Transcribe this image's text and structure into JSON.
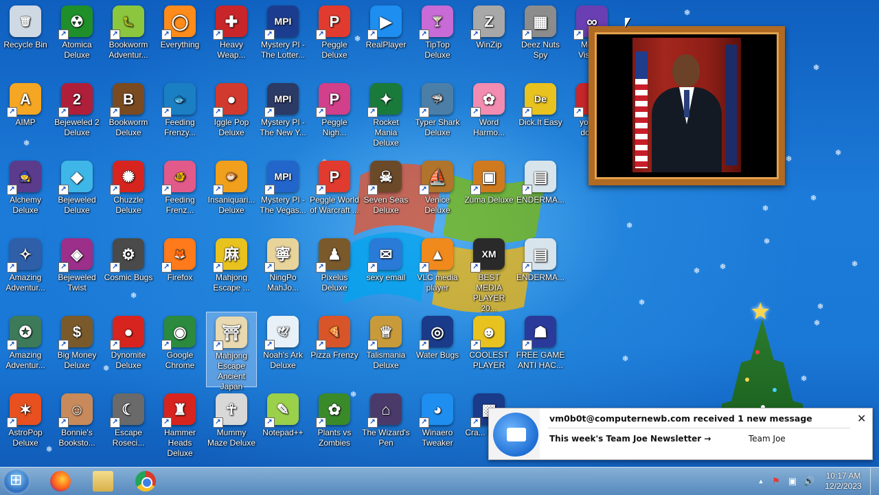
{
  "desktop": {
    "icons": [
      {
        "label": "Recycle Bin",
        "color": "#cfd9e4",
        "glyph": "🗑",
        "shortcut": false
      },
      {
        "label": "Atomica Deluxe",
        "color": "#1f8f2a",
        "glyph": "☢",
        "shortcut": true
      },
      {
        "label": "Bookworm Adventur...",
        "color": "#8cc63f",
        "glyph": "🐛",
        "shortcut": true
      },
      {
        "label": "Everything",
        "color": "#ff8c1a",
        "glyph": "◯",
        "shortcut": true
      },
      {
        "label": "Heavy Weap...",
        "color": "#c8262a",
        "glyph": "✚",
        "shortcut": true
      },
      {
        "label": "Mystery PI - The Lotter...",
        "color": "#1c3d8f",
        "glyph": "MPI",
        "shortcut": true
      },
      {
        "label": "Peggle Deluxe",
        "color": "#e03b2e",
        "glyph": "P",
        "shortcut": true
      },
      {
        "label": "RealPlayer",
        "color": "#1e8ef0",
        "glyph": "▶",
        "shortcut": true
      },
      {
        "label": "TipTop Deluxe",
        "color": "#c86bd6",
        "glyph": "🍸",
        "shortcut": true
      },
      {
        "label": "WinZip",
        "color": "#a8a8a8",
        "glyph": "Z",
        "shortcut": true
      },
      {
        "label": "Deez Nuts Spy",
        "color": "#8c8c8c",
        "glyph": "▦",
        "shortcut": true
      },
      {
        "label": "Micr... Visua...",
        "color": "#6a3fb4",
        "glyph": "∞",
        "shortcut": true
      },
      {
        "label": "AIMP",
        "color": "#f5a623",
        "glyph": "A",
        "shortcut": true
      },
      {
        "label": "Bejeweled 2 Deluxe",
        "color": "#b01f3a",
        "glyph": "2",
        "shortcut": true
      },
      {
        "label": "Bookworm Deluxe",
        "color": "#7a4a20",
        "glyph": "B",
        "shortcut": true
      },
      {
        "label": "Feeding Frenzy...",
        "color": "#1b7fc4",
        "glyph": "🐟",
        "shortcut": true
      },
      {
        "label": "Iggle Pop Deluxe",
        "color": "#d13a2f",
        "glyph": "●",
        "shortcut": true
      },
      {
        "label": "Mystery PI - The New Y...",
        "color": "#2c3a66",
        "glyph": "MPI",
        "shortcut": true
      },
      {
        "label": "Peggle Nigh...",
        "color": "#d23f8a",
        "glyph": "P",
        "shortcut": true
      },
      {
        "label": "Rocket Mania Deluxe",
        "color": "#1a7a3a",
        "glyph": "✦",
        "shortcut": true
      },
      {
        "label": "Typer Shark Deluxe",
        "color": "#4c7fa8",
        "glyph": "🦈",
        "shortcut": true
      },
      {
        "label": "Word Harmo...",
        "color": "#f28cb0",
        "glyph": "✿",
        "shortcut": true
      },
      {
        "label": "Dick.It Easy",
        "color": "#e8c21e",
        "glyph": "De",
        "shortcut": true
      },
      {
        "label": "you r... dont...",
        "color": "#c8262a",
        "glyph": "!",
        "shortcut": true
      },
      {
        "label": "Alchemy Deluxe",
        "color": "#5a3b8c",
        "glyph": "🧙",
        "shortcut": true
      },
      {
        "label": "Bejeweled Deluxe",
        "color": "#3fb6e8",
        "glyph": "◆",
        "shortcut": true
      },
      {
        "label": "Chuzzle Deluxe",
        "color": "#d8241f",
        "glyph": "✺",
        "shortcut": true
      },
      {
        "label": "Feeding Frenz...",
        "color": "#e25a8a",
        "glyph": "🐠",
        "shortcut": true
      },
      {
        "label": "Insaniquari... Deluxe",
        "color": "#f0a01c",
        "glyph": "🐡",
        "shortcut": true
      },
      {
        "label": "Mystery PI - The Vegas...",
        "color": "#2266cc",
        "glyph": "MPI",
        "shortcut": true
      },
      {
        "label": "Peggle World of Warcraft ...",
        "color": "#e03b2e",
        "glyph": "P",
        "shortcut": true
      },
      {
        "label": "Seven Seas Deluxe",
        "color": "#6b4a2a",
        "glyph": "☠",
        "shortcut": true
      },
      {
        "label": "Venice Deluxe",
        "color": "#b0742c",
        "glyph": "⛵",
        "shortcut": true
      },
      {
        "label": "Zuma Deluxe",
        "color": "#d07a1f",
        "glyph": "▣",
        "shortcut": true
      },
      {
        "label": "ENDERMA...",
        "color": "#d8e4ec",
        "glyph": "▤",
        "shortcut": true
      },
      {
        "label": "Amazing Adventur...",
        "color": "#2f5fa8",
        "glyph": "✧",
        "shortcut": true
      },
      {
        "label": "Bejeweled Twist",
        "color": "#9b2f8a",
        "glyph": "◈",
        "shortcut": true
      },
      {
        "label": "Cosmic Bugs",
        "color": "#4a4a4a",
        "glyph": "⚙",
        "shortcut": true
      },
      {
        "label": "Firefox",
        "color": "#ff7a1a",
        "glyph": "🦊",
        "shortcut": true
      },
      {
        "label": "Mahjong Escape ...",
        "color": "#e8c21e",
        "glyph": "麻",
        "shortcut": true
      },
      {
        "label": "NingPo MahJo...",
        "color": "#e8d49a",
        "glyph": "寧",
        "shortcut": true
      },
      {
        "label": "Pixelus Deluxe",
        "color": "#7a5a2a",
        "glyph": "♟",
        "shortcut": true
      },
      {
        "label": "sexy email",
        "color": "#2a7ad8",
        "glyph": "✉",
        "shortcut": true
      },
      {
        "label": "VLC media player",
        "color": "#f08a1c",
        "glyph": "▲",
        "shortcut": true
      },
      {
        "label": "BEST MEDIA PLAYER 20...",
        "color": "#2a2a2a",
        "glyph": "XM",
        "shortcut": true
      },
      {
        "label": "ENDERMA...",
        "color": "#d8e4ec",
        "glyph": "▤",
        "shortcut": true
      },
      {
        "label": "Amazing Adventur...",
        "color": "#3c7a5a",
        "glyph": "✪",
        "shortcut": true
      },
      {
        "label": "Big Money Deluxe",
        "color": "#7a5a2a",
        "glyph": "$",
        "shortcut": true
      },
      {
        "label": "Dynomite Deluxe",
        "color": "#d8241f",
        "glyph": "●",
        "shortcut": true
      },
      {
        "label": "Google Chrome",
        "color": "#2b8a3e",
        "glyph": "◉",
        "shortcut": true
      },
      {
        "label": "Mahjong Escape Ancient Japan",
        "color": "#e8d9b0",
        "glyph": "⛩",
        "shortcut": true
      },
      {
        "label": "Noah's Ark Deluxe",
        "color": "#e8f0f8",
        "glyph": "🕊",
        "shortcut": true
      },
      {
        "label": "Pizza Frenzy",
        "color": "#d8552a",
        "glyph": "🍕",
        "shortcut": true
      },
      {
        "label": "Talismania Deluxe",
        "color": "#c89a3a",
        "glyph": "♕",
        "shortcut": true
      },
      {
        "label": "Water Bugs",
        "color": "#1a3a8a",
        "glyph": "◎",
        "shortcut": true
      },
      {
        "label": "COOLEST PLAYER",
        "color": "#e8c21e",
        "glyph": "☻",
        "shortcut": true
      },
      {
        "label": "FREE GAME ANTI HAC...",
        "color": "#2a3a9a",
        "glyph": "☗",
        "shortcut": true
      },
      {
        "label": "AstroPop Deluxe",
        "color": "#e8501f",
        "glyph": "✶",
        "shortcut": true
      },
      {
        "label": "Bonnie's Booksto...",
        "color": "#c88a5a",
        "glyph": "☺",
        "shortcut": true
      },
      {
        "label": "Escape Roseci...",
        "color": "#6a6a6a",
        "glyph": "☾",
        "shortcut": true
      },
      {
        "label": "Hammer Heads Deluxe",
        "color": "#d8241f",
        "glyph": "♜",
        "shortcut": true
      },
      {
        "label": "Mummy Maze Deluxe",
        "color": "#d8d8d8",
        "glyph": "☥",
        "shortcut": true
      },
      {
        "label": "Notepad++",
        "color": "#9ad04a",
        "glyph": "✎",
        "shortcut": true
      },
      {
        "label": "Plants vs Zombies",
        "color": "#3a8a2a",
        "glyph": "✿",
        "shortcut": true
      },
      {
        "label": "The Wizard's Pen",
        "color": "#4a3a6a",
        "glyph": "⌂",
        "shortcut": true
      },
      {
        "label": "Winaero Tweaker",
        "color": "#1e8ef0",
        "glyph": "◕",
        "shortcut": true
      },
      {
        "label": "Cra... Brow...",
        "color": "#1a3a8a",
        "glyph": "▩",
        "shortcut": true
      }
    ]
  },
  "notification": {
    "title": "vm0b0t@computernewb.com received 1 new message",
    "subject": "This week's Team Joe Newsletter →",
    "sender": "Team Joe",
    "close_glyph": "✕"
  },
  "taskbar": {
    "clock_time": "10:17 AM",
    "clock_date": "12/2/2023",
    "tray_chevron": "▲",
    "tray_flag": "⚑",
    "tray_network": "▣",
    "tray_volume": "🔊"
  }
}
